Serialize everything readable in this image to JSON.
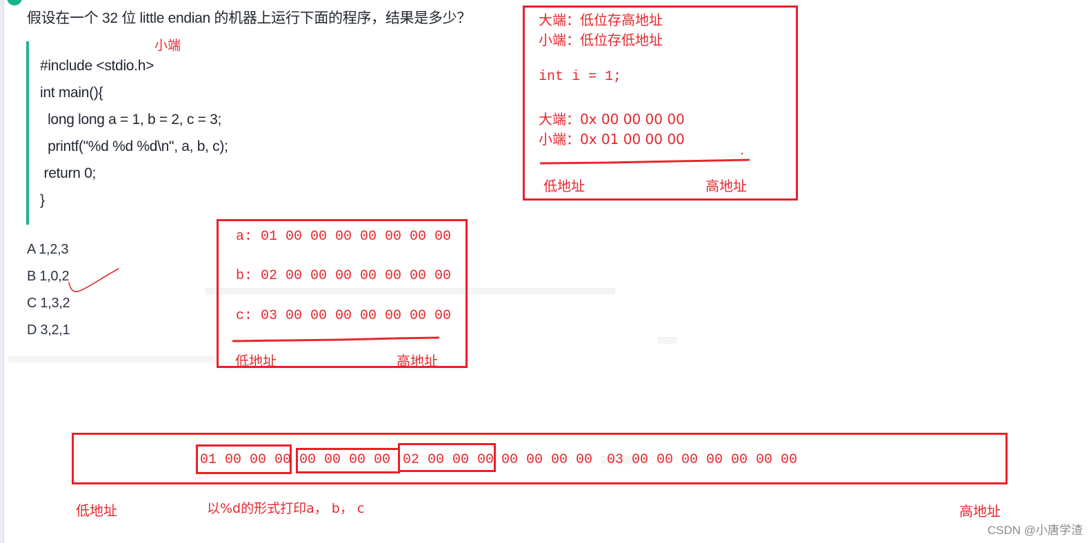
{
  "question": {
    "text": "假设在一个 32 位 little endian 的机器上运行下面的程序，结果是多少？"
  },
  "code": {
    "lines": [
      "#include <stdio.h>",
      "int main(){",
      "  long long a = 1, b = 2, c = 3;",
      "  printf(\"%d %d %d\\n\", a, b, c);",
      " return 0;",
      "}"
    ],
    "annotation": "小端"
  },
  "options": [
    {
      "label": "A 1,2,3"
    },
    {
      "label": "B 1,0,2"
    },
    {
      "label": "C 1,3,2"
    },
    {
      "label": "D 3,2,1"
    }
  ],
  "endian_note": {
    "big_endian_rule": "大端：低位存高地址",
    "little_endian_rule": "小端：低位存低地址",
    "example_decl": "int i = 1;",
    "big_endian_bytes": "大端：0x 00 00 00 00",
    "little_endian_bytes": "小端：0x 01 00 00 00",
    "low_addr": "低地址",
    "high_addr": "高地址"
  },
  "memory_layout": {
    "rows": [
      "a: 01 00 00 00 00 00 00 00",
      "b: 02 00 00 00 00 00 00 00",
      "c: 03 00 00 00 00 00 00 00"
    ],
    "low_addr": "低地址",
    "high_addr": "高地址"
  },
  "stack_strip": {
    "group1": "01 00 00 00",
    "group2": "00 00 00 00",
    "group3": "02 00 00 00",
    "rest1": "00 00 00 00",
    "rest2": "03 00 00 00 00 00 00 00",
    "low_addr": "低地址",
    "caption": "以%d的形式打印a， b， c",
    "high_addr": "高地址"
  },
  "watermark": "CSDN @小唐学渣",
  "colors": {
    "annotation_red": "#e8262d",
    "quote_bar_green": "#21b38e"
  }
}
